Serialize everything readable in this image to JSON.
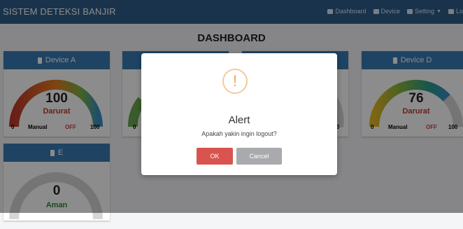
{
  "navbar": {
    "brand": "SISTEM DETEKSI BANJIR",
    "items": [
      {
        "label": "Dashboard",
        "icon": "dashboard-icon"
      },
      {
        "label": "Device",
        "icon": "device-icon"
      },
      {
        "label": "Setting",
        "icon": "gear-icon"
      },
      {
        "label": "Lo",
        "icon": "logout-icon"
      }
    ]
  },
  "page": {
    "title": "DASHBOARD"
  },
  "devices": [
    {
      "name": "Device A",
      "value": "100",
      "level": 1.0,
      "status": "Darurat",
      "status_color": "#c0392b",
      "min": "0",
      "max": "100",
      "mode": "Manual",
      "pump": "OFF"
    },
    {
      "name": "Device D",
      "value": "76",
      "level": 0.76,
      "status": "Darurat",
      "status_color": "#c0392b",
      "min": "0",
      "max": "100",
      "mode": "Manual",
      "pump": "OFF"
    },
    {
      "name": "E",
      "value": "0",
      "level": 0,
      "status": "Aman",
      "status_color": "#2e8b3a"
    }
  ],
  "partial_labels": {
    "b_min": "0",
    "c_max": "0"
  },
  "modal": {
    "title": "Alert",
    "message": "Apakah yakin ingin logout?",
    "ok_label": "OK",
    "cancel_label": "Cancel"
  },
  "colors": {
    "navbar": "#2f5d8a",
    "card_header": "#3a7ab5",
    "danger": "#d9534f",
    "alert_icon": "#f3a263"
  }
}
